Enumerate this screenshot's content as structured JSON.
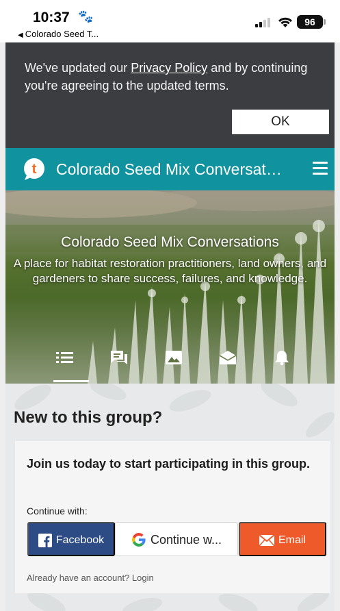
{
  "status_bar": {
    "time": "10:37",
    "paw_glyph": "🐾",
    "back_app": "Colorado Seed T...",
    "battery": "96"
  },
  "cookie_banner": {
    "text_before": "We've updated our ",
    "link": "Privacy Policy",
    "text_after": " and by continuing you're agreeing to the updated terms.",
    "ok_label": "OK"
  },
  "header": {
    "logo_letter": "t",
    "title": "Colorado Seed Mix Conversations",
    "accent_color": "#10929f"
  },
  "hero": {
    "title": "Colorado Seed Mix Conversations",
    "description": "A place for habitat restoration practitioners, land owners, and gardeners to share success, failures, and knowledge.",
    "tabs": [
      {
        "name": "list-icon"
      },
      {
        "name": "discussions-icon"
      },
      {
        "name": "photos-icon"
      },
      {
        "name": "mail-icon"
      },
      {
        "name": "bell-icon"
      }
    ],
    "active_tab": 0
  },
  "join": {
    "heading": "New to this group?",
    "card_text": "Join us today to start participating in this group.",
    "continue_label": "Continue with:",
    "facebook_label": "Facebook",
    "google_label": "Continue w...",
    "email_label": "Email",
    "login_text": "Already have an account? Login",
    "facebook_color": "#2d4b85",
    "email_color": "#ef5a2a"
  }
}
